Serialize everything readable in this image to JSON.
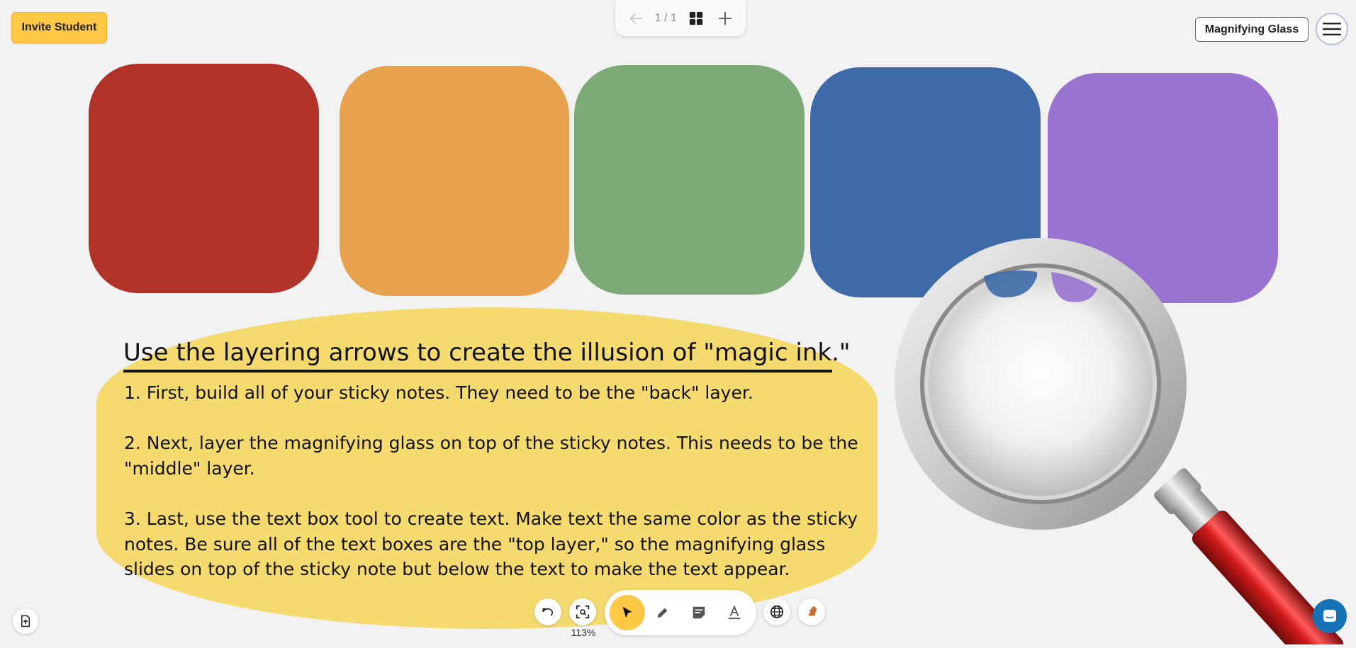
{
  "header": {
    "invite_label": "Invite Student",
    "pager": {
      "count": "1 / 1",
      "icons": [
        "arrow-left-icon",
        "grid-icon",
        "plus-icon"
      ]
    },
    "tool_name": "Magnifying Glass",
    "menu_icon": "hamburger-menu-icon"
  },
  "sticky_notes": [
    {
      "name": "red",
      "color": "#b03228"
    },
    {
      "name": "orange",
      "color": "#e8a14c"
    },
    {
      "name": "green",
      "color": "#7dab78"
    },
    {
      "name": "blue",
      "color": "#3e6ba7"
    },
    {
      "name": "purple",
      "color": "#9973cf"
    }
  ],
  "instructions": {
    "background": "#f4da6f",
    "title": "Use the layering arrows to create the illusion of \"magic ink.\"",
    "steps": [
      "1. First, build all of your sticky notes. They need to be the \"back\" layer.",
      "2. Next, layer the magnifying glass on top of the sticky notes. This needs to be the \"middle\" layer.",
      "3. Last, use the text box tool to create text. Make text the same color as the sticky notes. Be sure all of the text boxes are the \"top layer,\" so the magnifying glass slides on top of the sticky note but below the text to make the text appear."
    ]
  },
  "toolbar": {
    "zoom": "113%",
    "left_buttons": [
      "undo-icon",
      "fit-screen-icon"
    ],
    "tools": [
      "select-pointer-icon",
      "pencil-icon",
      "sticky-note-icon",
      "text-icon"
    ],
    "active_tool": "select-pointer-icon",
    "right_buttons": [
      "globe-icon",
      "squirrel-icon"
    ],
    "accent": "#ffc845"
  },
  "bottom_left_icon": "export-file-icon",
  "chat_icon": "chat-icon"
}
